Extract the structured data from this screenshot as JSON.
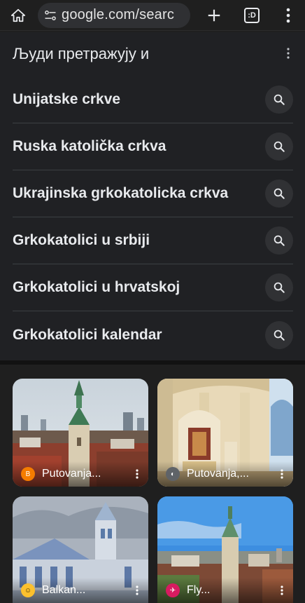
{
  "browser": {
    "url": "google.com/searc",
    "tab_count": ":D"
  },
  "pasf": {
    "header": "Људи претражују и",
    "items": [
      {
        "label": "Unijatske crkve"
      },
      {
        "label": "Ruska katolička crkva"
      },
      {
        "label": "Ukrajinska grkokatolicka crkva"
      },
      {
        "label": "Grkokatolici u srbiji"
      },
      {
        "label": "Grkokatolici u hrvatskoj"
      },
      {
        "label": "Grkokatolici kalendar"
      }
    ]
  },
  "images": [
    {
      "source": "Putovanja...",
      "favicon_color": "#f57c00"
    },
    {
      "source": "Putovanja,...",
      "favicon_color": "#5f6368"
    },
    {
      "source": "Balkan...",
      "favicon_color": "#fbc02d"
    },
    {
      "source": "Fly...",
      "favicon_color": "#d81b60"
    }
  ],
  "colors": {
    "background": "#1f1f1f",
    "card": "#202124",
    "text": "#e8eaed",
    "divider": "#3c4043"
  }
}
